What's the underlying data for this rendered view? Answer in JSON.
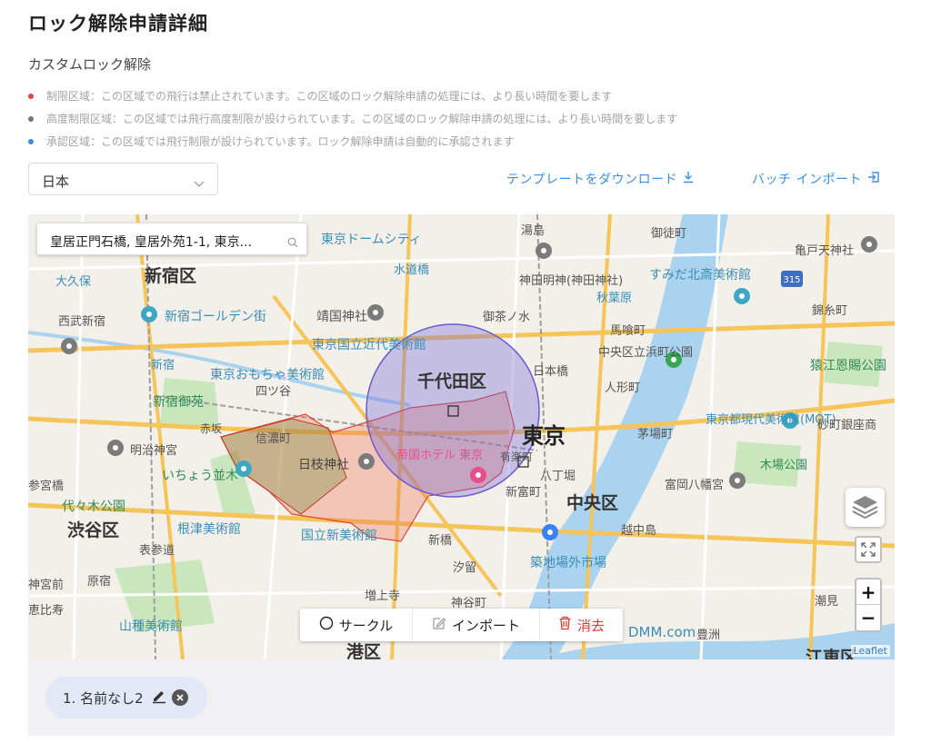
{
  "page": {
    "title": "ロック解除申請詳細",
    "section_title": "カスタムロック解除"
  },
  "legend": [
    {
      "color": "#f23d3d",
      "text": "制限区域：この区域での飛行は禁止されています。この区域のロック解除申請の処理には、より長い時間を要します"
    },
    {
      "color": "#767676",
      "text": "高度制限区域：この区域では飛行高度制限が設けられています。この区域のロック解除申請の処理には、より長い時間を要します"
    },
    {
      "color": "#3a8fe5",
      "text": "承認区域：この区域では飛行制限が設けられています。ロック解除申請は自動的に承認されます"
    }
  ],
  "region_select": {
    "value": "日本"
  },
  "actions": {
    "download_template": "テンプレートをダウンロード",
    "batch_import": "バッチ インポート"
  },
  "map": {
    "search_value": "皇居正門石橋, 皇居外苑1-1, 東京...",
    "attribution": "Leaflet",
    "zoom_in": "+",
    "zoom_out": "−",
    "labels": {
      "shinjuku_ward": "新宿区",
      "shibuya_ward": "渋谷区",
      "chiyoda_ward": "千代田区",
      "chuo_ward": "中央区",
      "minato_ward": "港区",
      "koto_ward": "江東区",
      "tokyo": "東京",
      "tokyo_dome": "東京ドームシティ",
      "okubo": "大久保",
      "seibu_shinjuku": "西武新宿",
      "shinjuku_station": "新宿",
      "golden_gai": "新宿ゴールデン街",
      "shinjuku_gyoen": "新宿御苑",
      "omocha_museum": "東京おもちゃ美術館",
      "yotsuya": "四ツ谷",
      "yasukuni": "靖国神社",
      "momat": "東京国立近代美術館",
      "suidobashi": "水道橋",
      "kanda_myojin": "神田明神(神田神社)",
      "akihabara": "秋葉原",
      "sumida_hokusai": "すみだ北斎美術館",
      "kameido_tenjin": "亀戸天神社",
      "yushima": "湯島",
      "okachimachi": "御徒町",
      "ochanomizu": "御茶ノ水",
      "bakuro": "馬喰町",
      "hamacho_park": "中央区立浜町公園",
      "ningyocho": "人形町",
      "kinshicho": "錦糸町",
      "sarue_park": "猿江恩賜公園",
      "nihonbashi": "日本橋",
      "kayabacho": "茅場町",
      "mot": "東京都現代美術館(MOT)",
      "sunamachi": "砂町銀座商",
      "kiba_park": "木場公園",
      "tomioka": "富岡八幡宮",
      "hie_jinja": "日枝神社",
      "imperial_hotel": "帝国ホテル 東京",
      "shinanomachi": "信濃町",
      "meiji_jingu": "明治神宮",
      "icho_namiki": "いちょう並木",
      "yoyogi_park": "代々木公園",
      "harajuku": "原宿",
      "omotesando": "表参道",
      "nezu": "根津美術館",
      "nact": "国立新美術館",
      "shinbashi": "新橋",
      "shiodome": "汐留",
      "zojoji": "増上寺",
      "tsukiji": "築地場外市場",
      "shintomicho": "新富町",
      "hatchobori": "八丁堀",
      "etchujima": "越中島",
      "toyosu": "豊洲",
      "shiome": "潮見",
      "yamatane": "山種美術館",
      "ebisu": "恵比寿",
      "kamiyacho": "神谷町",
      "dmm": "DMM.com",
      "sangubashi": "参宮橋",
      "jingumae": "神宮前",
      "akasaka": "赤坂",
      "yurakucho": "有楽町",
      "route": "315"
    }
  },
  "draw_toolbar": {
    "circle": "サークル",
    "import": "インポート",
    "clear": "消去"
  },
  "areas": [
    {
      "label": "1. 名前なし2"
    }
  ],
  "colors": {
    "link": "#3a8fe5",
    "danger": "#e53935",
    "restricted_fill": "#f0a080",
    "approval_circle": "#7b6fd8"
  }
}
